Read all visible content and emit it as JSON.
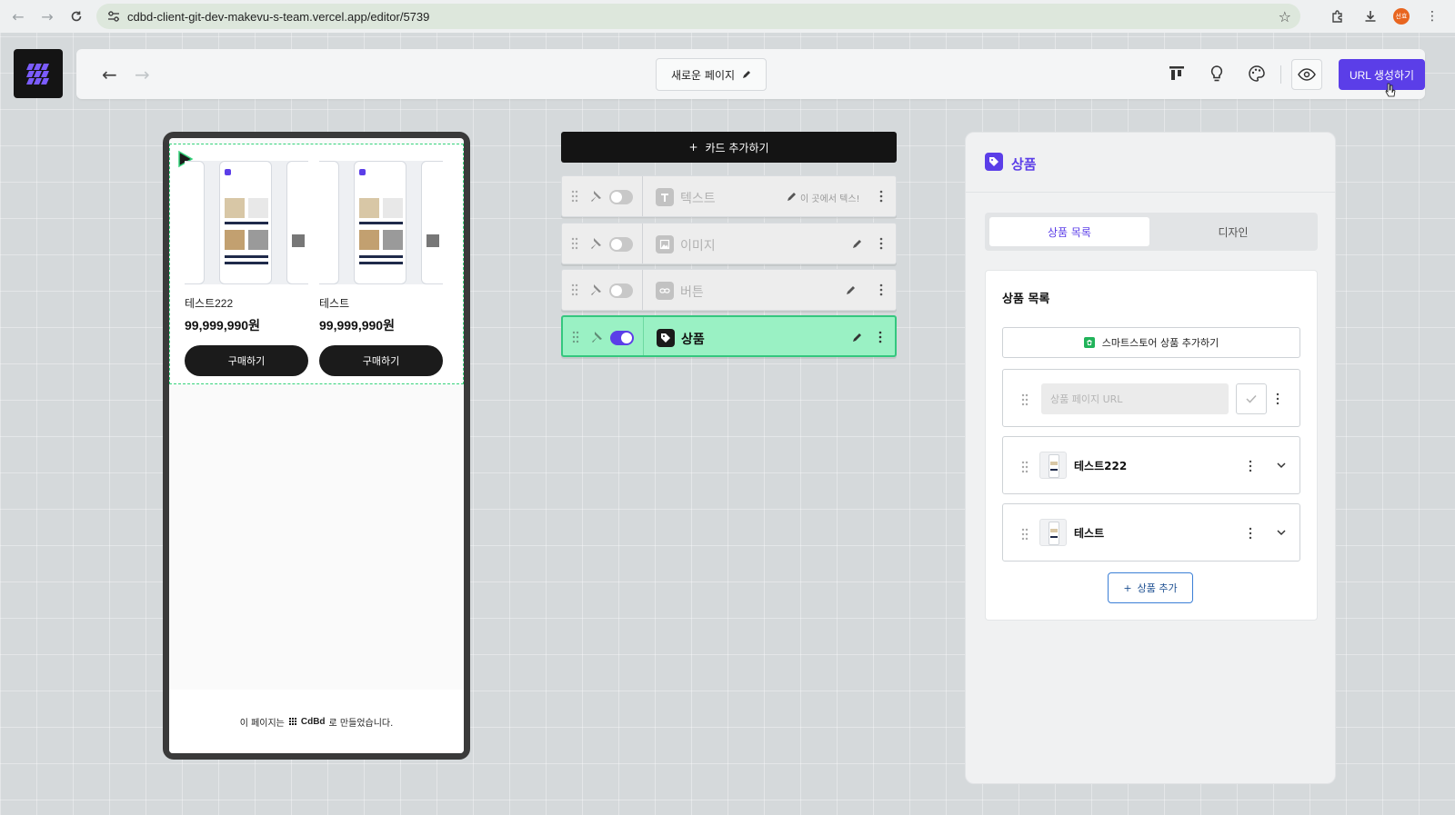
{
  "browser": {
    "url": "cdbd-client-git-dev-makevu-s-team.vercel.app/editor/5739",
    "profile_initials": "선효"
  },
  "toolbar": {
    "page_name": "새로운 페이지",
    "url_button_label": "URL 생성하기"
  },
  "phone": {
    "products": [
      {
        "name": "테스트222",
        "price": "99,999,990원",
        "buy_label": "구매하기"
      },
      {
        "name": "테스트",
        "price": "99,999,990원",
        "buy_label": "구매하기"
      }
    ],
    "footer_prefix": "이 페이지는",
    "footer_brand": "CdBd",
    "footer_suffix": "로 만들었습니다."
  },
  "cards": {
    "add_label": "카드 추가하기",
    "items": [
      {
        "label": "텍스트",
        "hint": "이 곳에서 텍스!",
        "enabled": false,
        "active": false
      },
      {
        "label": "이미지",
        "hint": "",
        "enabled": false,
        "active": false
      },
      {
        "label": "버튼",
        "hint": "",
        "enabled": false,
        "active": false
      },
      {
        "label": "상품",
        "hint": "",
        "enabled": true,
        "active": true
      }
    ]
  },
  "panel": {
    "title": "상품",
    "tabs": [
      "상품 목록",
      "디자인"
    ],
    "selected_tab": "상품 목록",
    "list_title": "상품 목록",
    "smartstore_label": "스마트스토어 상품 추가하기",
    "url_placeholder": "상품 페이지 URL",
    "products": [
      "테스트222",
      "테스트"
    ],
    "add_product_label": "상품 추가"
  },
  "colors": {
    "accent": "#5b3ee8",
    "active_card": "#9af1c4",
    "smartstore_green": "#21b35a"
  }
}
